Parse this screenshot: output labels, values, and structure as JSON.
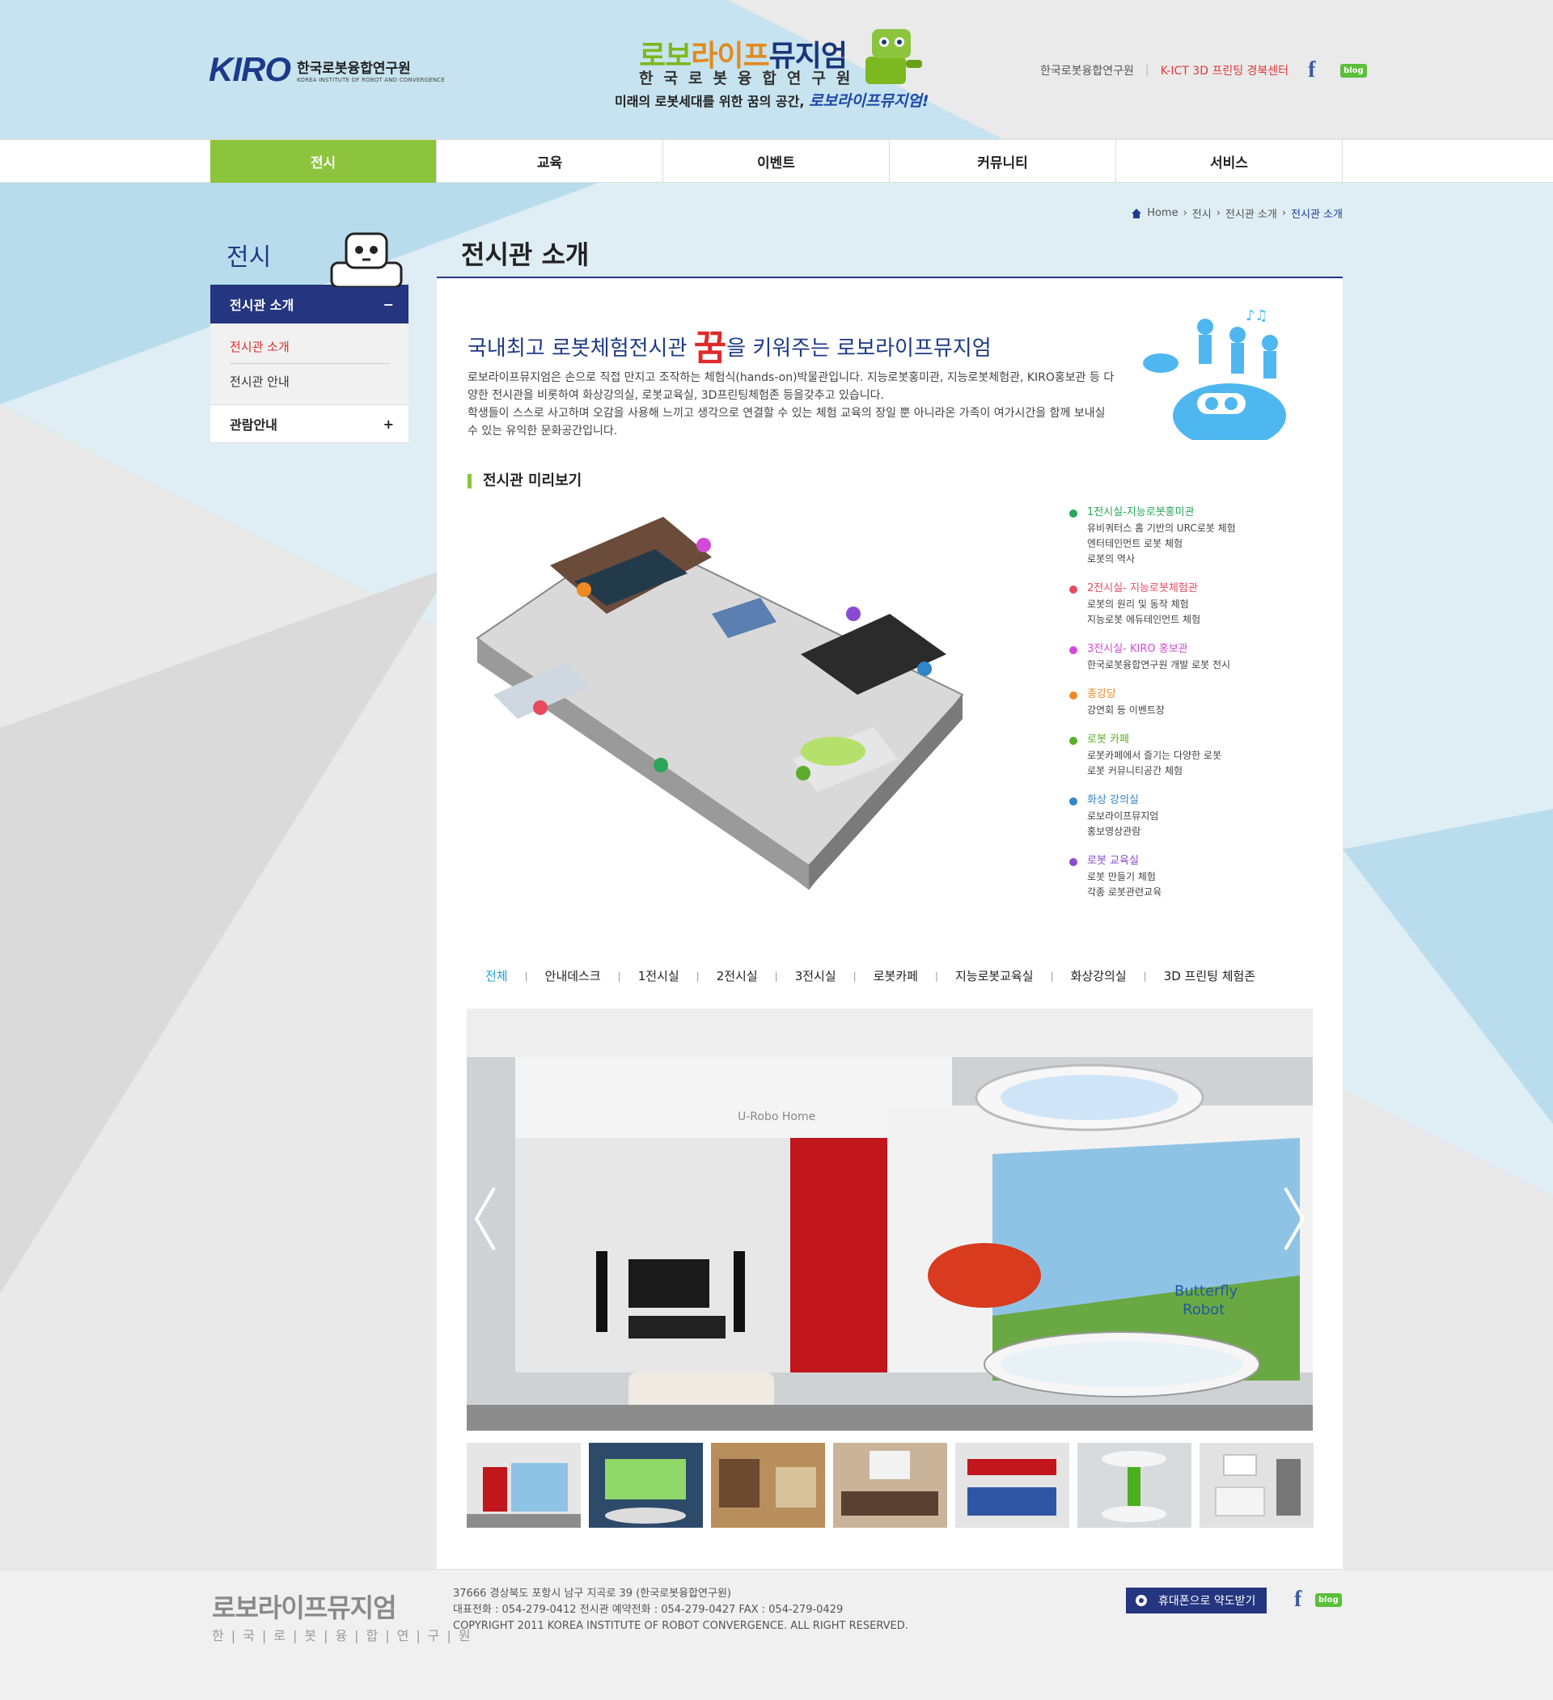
{
  "header": {
    "kiro_mark": "KIRO",
    "kiro_name": "한국로봇융합연구원",
    "kiro_name_en": "KOREA INSTITUTE OF ROBOT AND CONVERGENCE",
    "museum_title_1": "로보",
    "museum_title_2": "라이프",
    "museum_title_3": "뮤지엄",
    "museum_sub": "한국로봇융합연구원",
    "tagline": "미래의 로봇세대를 위한 꿈의 공간,",
    "tagline_em": "로보라이프뮤지엄!",
    "links": [
      {
        "label": "한국로봇융합연구원"
      },
      {
        "label": "K-ICT 3D 프린팅 경북센터"
      }
    ],
    "facebook": "f",
    "blog": "blog"
  },
  "nav": [
    "전시",
    "교육",
    "이벤트",
    "커뮤니티",
    "서비스"
  ],
  "breadcrumb": [
    "Home",
    "전시",
    "전시관 소개",
    "전시관 소개"
  ],
  "sidebar": {
    "title": "전시",
    "active": "전시관 소개",
    "active_toggle": "−",
    "sub": [
      "전시관 소개",
      "전시관 안내"
    ],
    "other": "관람안내",
    "other_toggle": "+"
  },
  "page_title": "전시관 소개",
  "intro": {
    "heading_pre": "국내최고 로봇체험전시관",
    "heading_dream": "꿈",
    "heading_post": "을 키워주는 로보라이프뮤지엄",
    "para1": "로보라이프뮤지엄은 손으로 직접 만지고 조작하는 체험식(hands-on)박물관입니다. 지능로봇홍미관, 지능로봇체험관, KIRO홍보관 등 다양한 전시관을 비롯하여 화상강의실, 로봇교육실, 3D프린팅체험존 등을갖추고 있습니다.",
    "para2": "학생들이 스스로 사고하며 오감을 사용해 느끼고 생각으로 연결할 수 있는 체험 교육의 장일 뿐 아니라온 가족이 여가시간을 함께 보내실 수 있는 유익한 문화공간입니다."
  },
  "preview_title": "전시관 미리보기",
  "legend": [
    {
      "title": "1전시실-지능로봇홍미관",
      "color": "#2aa55a",
      "desc": [
        "유비쿼터스 홈 기반의 URC로봇 체험",
        "엔터테인먼트 로봇 체험",
        "로봇의 역사"
      ]
    },
    {
      "title": "2전시실- 지능로봇체험관",
      "color": "#e84a5f",
      "desc": [
        "로봇의 원리 및 동작 체험",
        "지능로봇 에듀테인먼트 체험"
      ]
    },
    {
      "title": "3전시실- KIRO 홍보관",
      "color": "#d24bd6",
      "desc": [
        "한국로봇융합연구원 개발 로봇 전시"
      ]
    },
    {
      "title": "종강당",
      "color": "#ee8a23",
      "desc": [
        "강연회 등 이벤트장"
      ]
    },
    {
      "title": "로봇 카페",
      "color": "#5aad2a",
      "desc": [
        "로봇카페에서 즐기는 다양한 로봇",
        "로봇 커뮤니티공간 체험"
      ]
    },
    {
      "title": "화상 강의실",
      "color": "#2f86c8",
      "desc": [
        "로보라이프뮤지엄",
        "홍보영상관람"
      ]
    },
    {
      "title": "로봇 교육실",
      "color": "#8a4bd0",
      "desc": [
        "로봇 만들기 체험",
        "각종 로봇관련교육"
      ]
    }
  ],
  "tabs": [
    "전체",
    "안내데스크",
    "1전시실",
    "2전시실",
    "3전시실",
    "로봇카페",
    "지능로봇교육실",
    "화상강의실",
    "3D 프린팅 체험존"
  ],
  "photo": {
    "sign": "U-Robo Home",
    "wall_text_1": "Butterfly",
    "wall_text_2": "Robot"
  },
  "footer": {
    "logo": "로보라이프뮤지엄",
    "logo_sub": "한|국|로|봇|융|합|연|구|원",
    "address": "37666 경상북도 포항시 남구 지곡로 39 (한국로봇융합연구원)",
    "phones": "대표전화 : 054-279-0412   전시관 예약전화 : 054-279-0427   FAX : 054-279-0429",
    "copyright": "COPYRIGHT 2011 KOREA INSTITUTE OF ROBOT CONVERGENCE. ALL RIGHT RESERVED.",
    "map_button": "휴대폰으로 약도받기"
  },
  "colors": {
    "primary": "#253580",
    "accent": "#8cc43d",
    "active_red": "#e02a2a",
    "tab_active": "#1aa0d8"
  }
}
